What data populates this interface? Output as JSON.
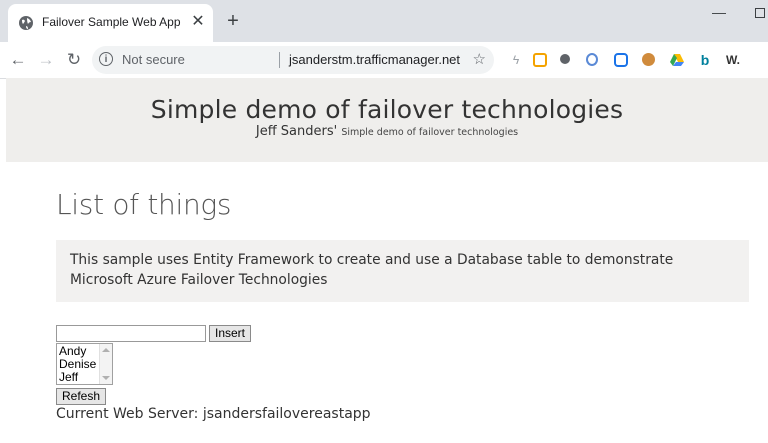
{
  "browser": {
    "tab_title": "Failover Sample Web App",
    "tab_close": "✕",
    "new_tab": "+",
    "minimize": "—",
    "back": "←",
    "forward": "→",
    "reload": "↻",
    "security_label": "Not secure",
    "url": "jsanderstm.trafficmanager.net",
    "extensions": [
      "lightning-icon",
      "note-icon",
      "circle-icon",
      "opera-icon",
      "chat-icon",
      "cookie-icon",
      "drive-icon",
      "bing-icon",
      "w-icon"
    ],
    "ext_w_label": "W."
  },
  "hero": {
    "title": "Simple demo of failover technologies",
    "subtitle_main": "Jeff Sanders'",
    "subtitle_small": "Simple demo of failover technologies"
  },
  "main": {
    "heading": "List of things",
    "info_text": "This sample uses Entity Framework to create and use a Database table to demonstrate Microsoft Azure Failover Technologies",
    "input_value": "",
    "insert_label": "Insert",
    "list_items": [
      "Andy",
      "Denise",
      "Jeff"
    ],
    "refresh_label": "Refesh",
    "server_text": "Current Web Server: jsandersfailovereastapp"
  },
  "colors": {
    "chrome_bg": "#dee1e6",
    "hero_bg": "#efeeec",
    "info_bg": "#f2f1f0"
  }
}
